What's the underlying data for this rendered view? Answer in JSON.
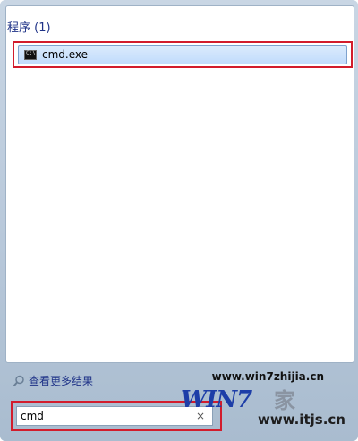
{
  "results": {
    "group_label": "程序 (1)",
    "items": [
      {
        "label": "cmd.exe",
        "icon": "cmd-icon"
      }
    ]
  },
  "see_more": {
    "label": "查看更多结果",
    "icon": "search-icon"
  },
  "search": {
    "value": "cmd",
    "clear_glyph": "×"
  },
  "watermark": {
    "url_top": "www.win7zhijia.cn",
    "logo_text": "WIN7",
    "cn_text": "家",
    "url_bottom": "www.itjs.cn"
  },
  "colors": {
    "highlight": "#d21c2c",
    "selection_fill": "#c1dcfc",
    "header_text": "#1e3287"
  }
}
